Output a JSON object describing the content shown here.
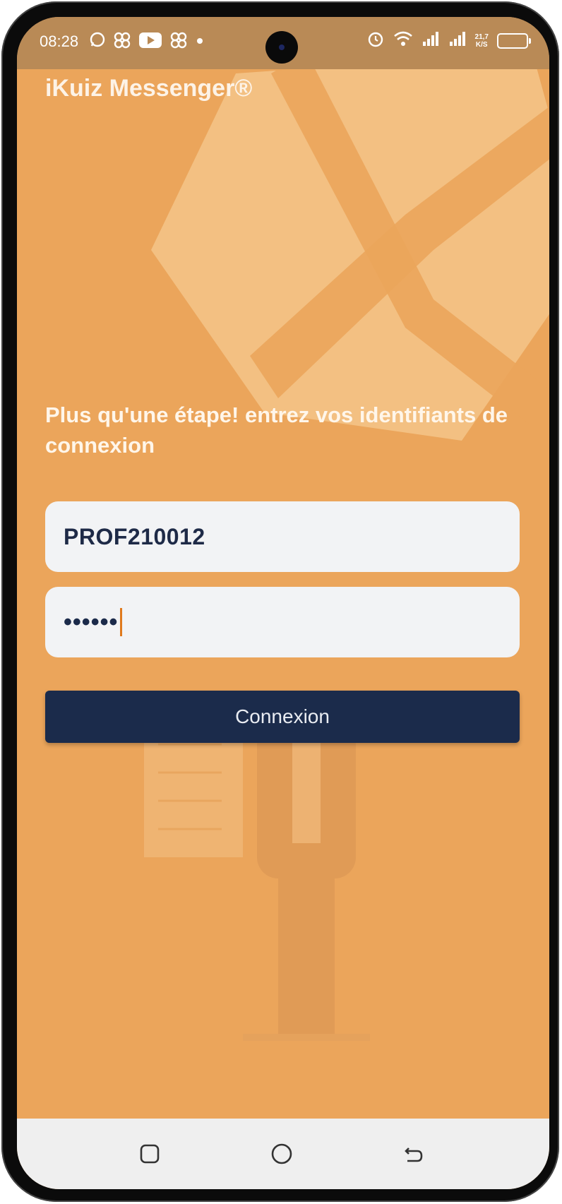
{
  "status_bar": {
    "time": "08:28",
    "left_icons": [
      "whatsapp-icon",
      "pinwheel-icon",
      "youtube-icon",
      "pinwheel-icon",
      "dot-icon"
    ],
    "right_icons": [
      "alarm-icon",
      "wifi-icon",
      "signal-icon",
      "signal-icon",
      "battery-icon"
    ],
    "net_speed_value": "21,7",
    "net_speed_unit": "K/S"
  },
  "app": {
    "title": "iKuiz Messenger®"
  },
  "login": {
    "instruction": "Plus qu'une étape! entrez vos identifiants de connexion",
    "username_value": "PROF210012",
    "password_masked": "••••••",
    "submit_label": "Connexion"
  },
  "colors": {
    "background": "#eba55b",
    "button": "#1b2b4b",
    "input": "#f2f3f5",
    "caret": "#e07a1d"
  },
  "nav_bar": {
    "buttons": [
      "recent-apps-icon",
      "home-icon",
      "back-icon"
    ]
  }
}
